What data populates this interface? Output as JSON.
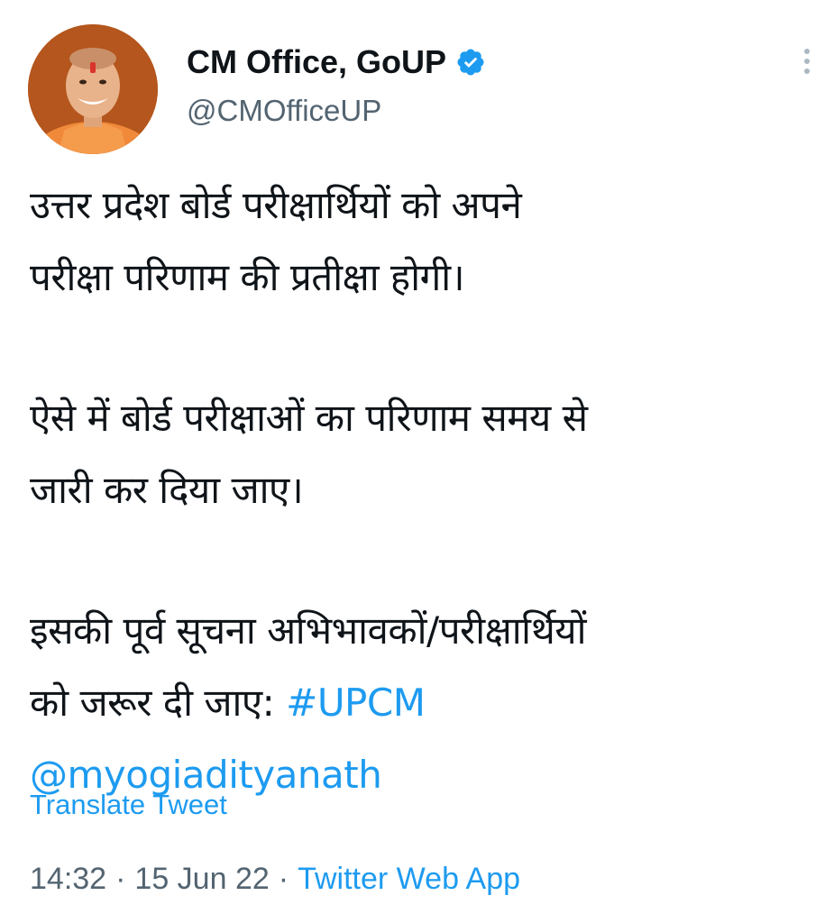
{
  "author": {
    "name": "CM Office, GoUP",
    "handle": "@CMOfficeUP",
    "verified_icon": "verified-badge-icon",
    "verified_color": "#1d9bf0"
  },
  "more_icon": "more-options-icon",
  "tweet": {
    "para1_line1": "उत्तर प्रदेश बोर्ड परीक्षार्थियों को अपने",
    "para1_line2": "परीक्षा परिणाम की प्रतीक्षा होगी।",
    "para2_line1": "ऐसे में बोर्ड परीक्षाओं का परिणाम समय से",
    "para2_line2": "जारी कर दिया जाए।",
    "para3_line1": "इसकी पूर्व सूचना अभिभावकों/परीक्षार्थियों",
    "para3_line2_text": "को जरूर दी जाए: ",
    "hashtag": "#UPCM",
    "mention": "@myogiadityanath"
  },
  "translate_label": "Translate Tweet",
  "meta": {
    "time": "14:32",
    "separator": "·",
    "date": "15 Jun 22",
    "source": "Twitter Web App"
  },
  "colors": {
    "link": "#1d9bf0",
    "secondary_text": "#536471",
    "primary_text": "#0f1419"
  }
}
